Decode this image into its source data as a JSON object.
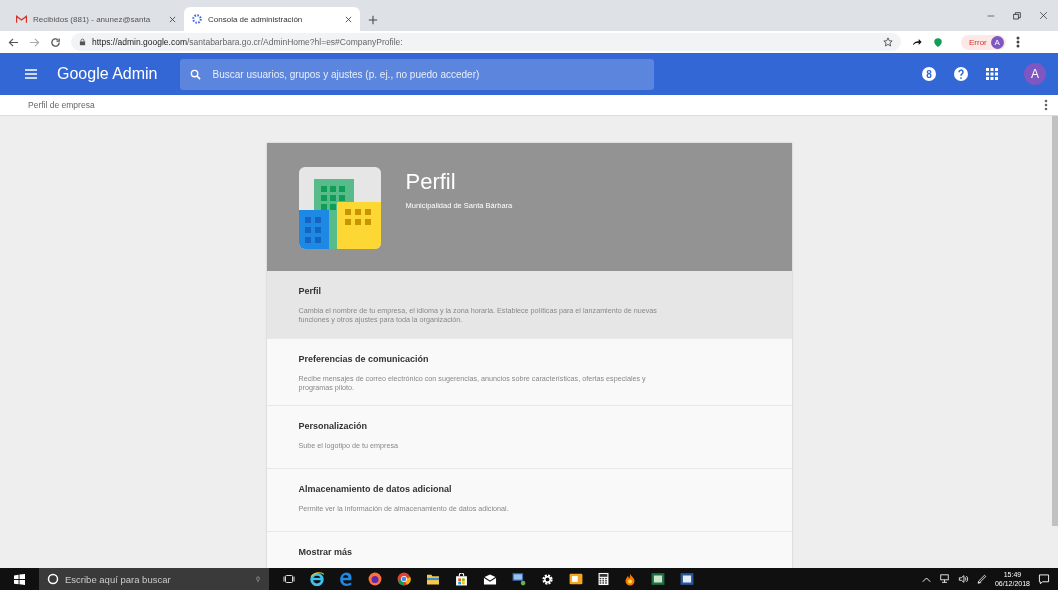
{
  "browser": {
    "tabs": [
      {
        "title": "Recibidos (881) - anunez@santa",
        "selected": false,
        "kind": "mail"
      },
      {
        "title": "Consola de administración",
        "selected": true,
        "kind": "admin"
      }
    ],
    "url": {
      "host": "https://admin.google.com",
      "path": "/santabarbara.go.cr/AdminHome?hl=es#CompanyProfile:"
    },
    "profile": {
      "status": "Error",
      "avatar": "A"
    }
  },
  "header": {
    "title": "Google Admin",
    "search": {
      "placeholder": "Buscar usuarios, grupos y ajustes (p. ej., no puedo acceder)"
    },
    "notification_count": "8",
    "avatar": "A"
  },
  "breadcrumb": "Perfil de empresa",
  "profile_card": {
    "title": "Perfil",
    "subtitle": "Municipalidad de Santa Bárbara"
  },
  "sections": [
    {
      "title": "Perfil",
      "description": "Cambia el nombre de tu empresa, el idioma y la zona horaria. Establece políticas para el lanzamiento de nuevas funciones y otros ajustes para toda la organización.",
      "selected": true
    },
    {
      "title": "Preferencias de comunicación",
      "description": "Recibe mensajes de correo electrónico con sugerencias, anuncios sobre características, ofertas especiales y programas piloto.",
      "selected": false
    },
    {
      "title": "Personalización",
      "description": "Sube el logotipo de tu empresa",
      "selected": false
    },
    {
      "title": "Almacenamiento de datos adicional",
      "description": "Permite ver la información de almacenamiento de datos adicional.",
      "selected": false
    },
    {
      "title": "Mostrar más",
      "selected": false
    }
  ],
  "taskbar": {
    "search_placeholder": "Escribe aquí para buscar",
    "time": "15:49",
    "date": "06/12/2018"
  }
}
